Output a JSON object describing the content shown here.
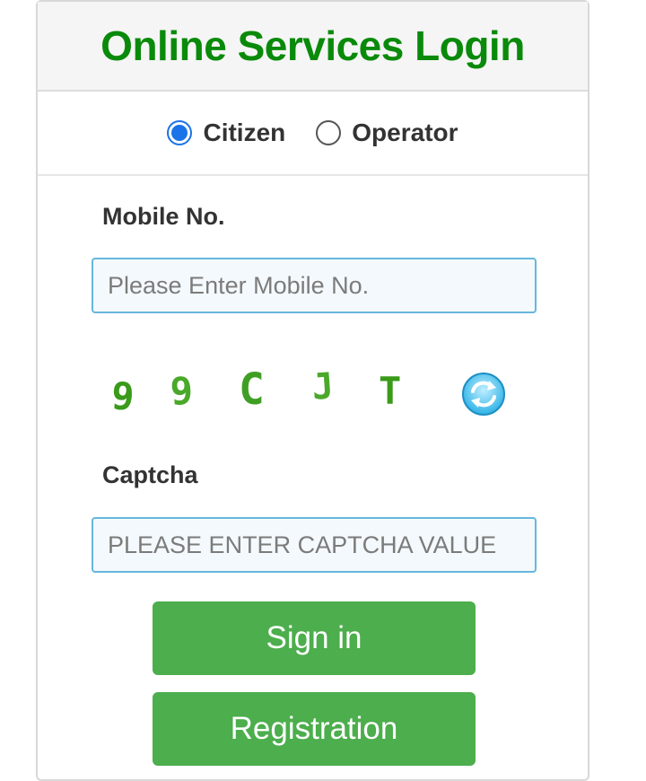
{
  "header": {
    "title": "Online Services Login"
  },
  "roles": [
    {
      "label": "Citizen",
      "selected": true
    },
    {
      "label": "Operator",
      "selected": false
    }
  ],
  "mobile": {
    "label": "Mobile No.",
    "placeholder": "Please Enter Mobile No.",
    "value": ""
  },
  "captcha": {
    "characters": [
      "9",
      "9",
      "C",
      "J",
      "T"
    ],
    "label": "Captcha",
    "placeholder": "PLEASE ENTER CAPTCHA VALUE",
    "value": "",
    "refresh_icon": "refresh-icon"
  },
  "buttons": {
    "sign_in": "Sign in",
    "registration": "Registration"
  },
  "colors": {
    "title": "#0a8a0a",
    "button": "#4cae4c",
    "radio_selected": "#1a73e8",
    "input_border": "#66b7dd",
    "captcha_text": "#3a9a1a"
  }
}
